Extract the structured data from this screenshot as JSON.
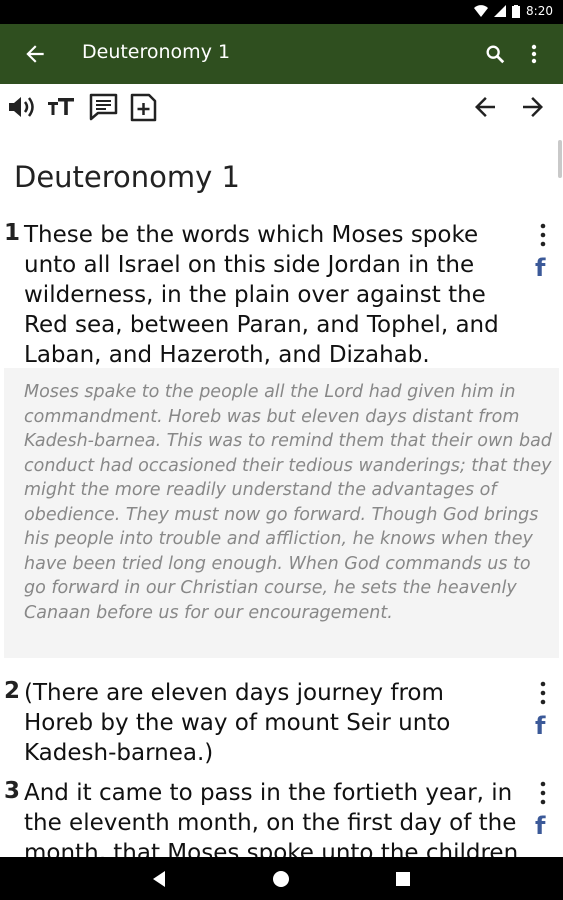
{
  "status": {
    "time": "8:20"
  },
  "app_bar": {
    "title": "Deuteronomy 1",
    "back_icon": "arrow-left-icon",
    "search_icon": "search-icon",
    "more_icon": "more-vert-icon"
  },
  "toolbar": {
    "icons": [
      "volume-icon",
      "text-size-icon",
      "comment-icon",
      "add-note-icon"
    ],
    "prev_icon": "arrow-left-icon",
    "next_icon": "arrow-right-icon"
  },
  "content": {
    "chapter_title": "Deuteronomy 1",
    "verses": [
      {
        "number": "1",
        "text": "These be the words which Moses spoke unto all Israel on this side Jordan in the wilderness, in the plain over against the Red sea, between Paran, and Tophel, and Laban, and Hazeroth, and Dizahab."
      },
      {
        "number": "2",
        "text": "(There are eleven days journey from Horeb by the way of mount Seir unto Kadesh-barnea.)"
      },
      {
        "number": "3",
        "text": "And it came to pass in the fortieth year, in the eleventh month, on the first day of the month, that Moses spoke unto the children"
      }
    ],
    "commentary": "Moses spake to the people all the Lord had given him in commandment. Horeb was but eleven days distant from Kadesh-barnea. This was to remind them that their own bad conduct had occasioned their tedious wanderings; that they might the more readily understand the advantages of obedience. They must now go forward. Though God brings his people into trouble and affliction, he knows when they have been tried long enough. When God commands us to go forward in our Christian course, he sets the heavenly Canaan before us for our encouragement.",
    "share_icon_text": "f"
  },
  "colors": {
    "app_bar": "#2f4f1f",
    "facebook": "#3b5998",
    "commentary_bg": "#f4f4f4"
  }
}
